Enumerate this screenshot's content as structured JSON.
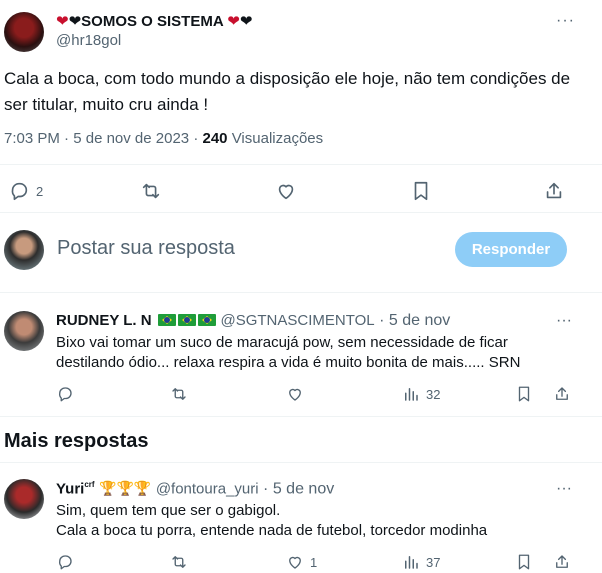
{
  "tweet": {
    "name": "SOMOS O SISTEMA",
    "handle": "@hr18gol",
    "text": "Cala a boca, com todo mundo a disposição ele hoje, não tem condições de ser titular, muito cru ainda !",
    "time": "7:03 PM",
    "date": "5 de nov de 2023",
    "views_count": "240",
    "views_label": "Visualizações",
    "more": "···",
    "actions": {
      "replies": "2"
    }
  },
  "composer": {
    "placeholder": "Postar sua resposta",
    "button": "Responder"
  },
  "replies_primary": [
    {
      "name": "RUDNEY L. N",
      "handle": "@SGTNASCIMENTOL",
      "date": "5 de nov",
      "text": "Bixo vai tomar um suco de maracujá pow, sem necessidade de ficar destilando ódio... relaxa respira a vida é muito bonita de mais..... SRN",
      "views": "32",
      "more": "···"
    }
  ],
  "section_title": "Mais respostas",
  "replies_more": [
    {
      "name": "Yuri",
      "superscript": "crf",
      "handle": "@fontoura_yuri",
      "date": "5 de nov",
      "line1": "Sim, quem tem que ser o gabigol.",
      "line2": "Cala a boca tu porra, entende nada de futebol, torcedor modinha",
      "likes": "1",
      "views": "37",
      "more": "···"
    }
  ],
  "separator": "·",
  "colors": {
    "accent": "#1d9bf0",
    "button_disabled": "#8ecdf7",
    "muted": "#536471",
    "heart_red": "#c8102e",
    "heart_black": "#0f1419"
  }
}
